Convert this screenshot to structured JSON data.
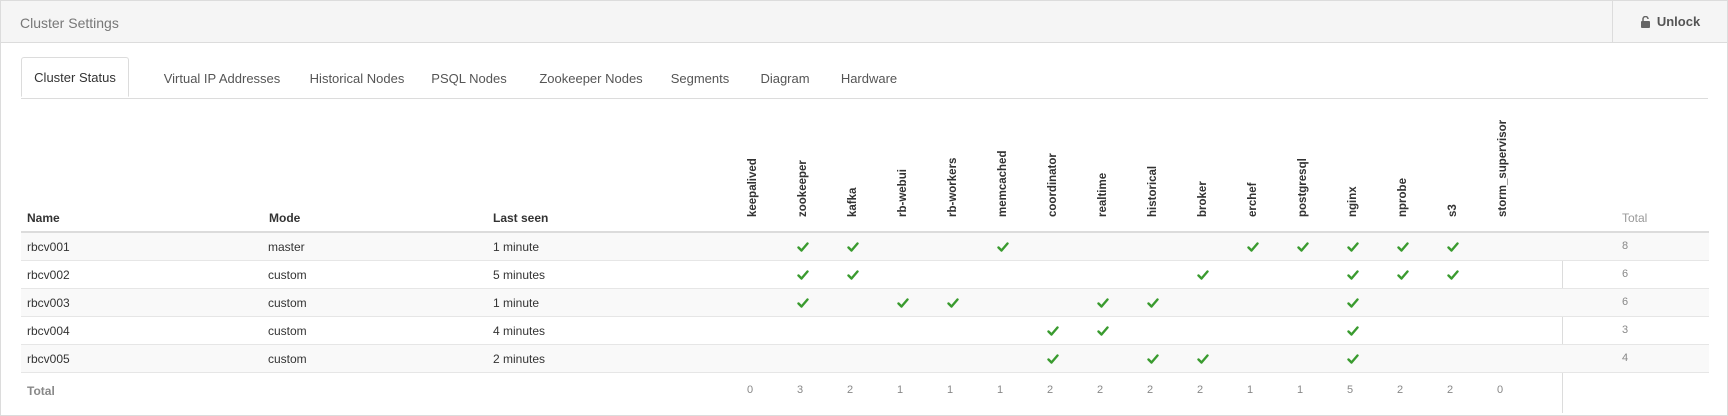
{
  "panel": {
    "title": "Cluster Settings",
    "unlock_label": "Unlock"
  },
  "tabs": [
    {
      "label": "Cluster Status",
      "active": true
    },
    {
      "label": "Virtual IP Addresses"
    },
    {
      "label": "Historical Nodes"
    },
    {
      "label": "PSQL Nodes"
    },
    {
      "label": "Zookeeper Nodes"
    },
    {
      "label": "Segments"
    },
    {
      "label": "Diagram"
    },
    {
      "label": "Hardware"
    }
  ],
  "table": {
    "headers": {
      "name": "Name",
      "mode": "Mode",
      "last_seen": "Last seen",
      "total": "Total"
    },
    "services": [
      "keepalived",
      "zookeeper",
      "kafka",
      "rb-webui",
      "rb-workers",
      "memcached",
      "coordinator",
      "realtime",
      "historical",
      "broker",
      "erchef",
      "postgresql",
      "nginx",
      "nprobe",
      "s3",
      "storm_supervisor"
    ],
    "rows": [
      {
        "name": "rbcv001",
        "mode": "master",
        "last_seen": "1 minute",
        "services": [
          "zookeeper",
          "kafka",
          "memcached",
          "erchef",
          "postgresql",
          "nginx",
          "nprobe",
          "s3"
        ],
        "total": "8"
      },
      {
        "name": "rbcv002",
        "mode": "custom",
        "last_seen": "5 minutes",
        "services": [
          "zookeeper",
          "kafka",
          "broker",
          "nginx",
          "nprobe",
          "s3"
        ],
        "total": "6"
      },
      {
        "name": "rbcv003",
        "mode": "custom",
        "last_seen": "1 minute",
        "services": [
          "zookeeper",
          "rb-webui",
          "rb-workers",
          "realtime",
          "historical",
          "nginx"
        ],
        "total": "6"
      },
      {
        "name": "rbcv004",
        "mode": "custom",
        "last_seen": "4 minutes",
        "services": [
          "coordinator",
          "realtime",
          "nginx"
        ],
        "total": "3"
      },
      {
        "name": "rbcv005",
        "mode": "custom",
        "last_seen": "2 minutes",
        "services": [
          "coordinator",
          "historical",
          "broker",
          "nginx"
        ],
        "total": "4"
      }
    ],
    "totals": {
      "label": "Total",
      "values": [
        "0",
        "3",
        "2",
        "1",
        "1",
        "1",
        "2",
        "2",
        "2",
        "2",
        "1",
        "1",
        "5",
        "2",
        "2",
        "0"
      ]
    }
  },
  "colors": {
    "check": "#3a9b2f",
    "border": "#dcdcdc",
    "header_bg": "#f5f5f5"
  }
}
